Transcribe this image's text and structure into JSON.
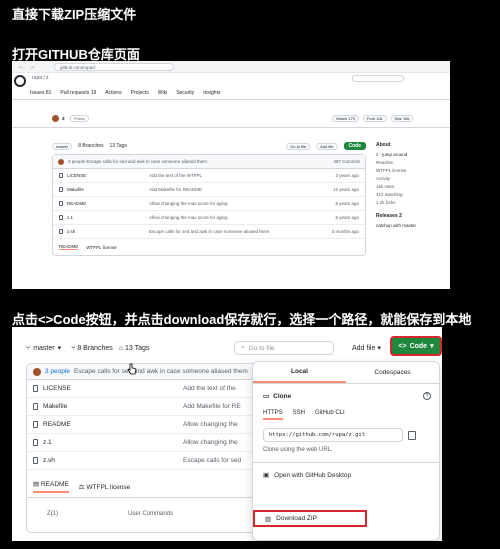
{
  "headings": {
    "step1": "直接下载ZIP压缩文件",
    "step2": "打开GITHUB仓库页面",
    "step3": "点击<>Code按钮，并点击download保存就行，选择一个路径，就能保存到本地"
  },
  "shot1": {
    "url": "github.com/rupa/z",
    "top_path": "rupa / z",
    "tabs": [
      "Issues 81",
      "Pull requests 19",
      "Actions",
      "Projects",
      "Wiki",
      "Security",
      "Insights"
    ],
    "owner": "z",
    "visibility": "Public",
    "watch": "Watch 179",
    "fork": "Fork 12k",
    "star": "Star 16k",
    "branch": "master",
    "branches": "8 Branches",
    "tags": "13 Tags",
    "go_to_file": "Go to file",
    "add_file": "Add file",
    "code": "Code",
    "commit_msg": "3 people  Escape calls for sed and awk in case someone aliased them",
    "commit_count": "287 Commits",
    "files": [
      {
        "name": "LICENSE",
        "msg": "Add the text of the WTFPL",
        "time": "3 years ago"
      },
      {
        "name": "Makefile",
        "msg": "Add Makefile for README",
        "time": "12 years ago"
      },
      {
        "name": "README",
        "msg": "Allow changing the max score for aging",
        "time": "6 years ago"
      },
      {
        "name": "z.1",
        "msg": "Allow changing the max score for aging",
        "time": "6 years ago"
      },
      {
        "name": "z.sh",
        "msg": "Escape calls for sed and awk in case someone aliased them",
        "time": "3 months ago"
      }
    ],
    "readme_tab": "README",
    "license_tab": "WTFPL license",
    "about_title": "About",
    "about_desc": "z - jump around",
    "about_items": [
      "Readme",
      "WTFPL license",
      "Activity",
      "16k stars",
      "312 watching",
      "1.2k forks"
    ],
    "releases": "Releases  2",
    "release_item": "catchup with master"
  },
  "shot2": {
    "branch": "master",
    "branches": "8 Branches",
    "tags": "13 Tags",
    "go_to_file": "Go to file",
    "add_file": "Add file",
    "code": "Code",
    "commit_people": "3 people",
    "commit_msg": "Escape calls for sed and awk in case someone aliased them",
    "files": [
      {
        "name": "LICENSE",
        "msg": "Add the text of the"
      },
      {
        "name": "Makefile",
        "msg": "Add Makefile for RE"
      },
      {
        "name": "README",
        "msg": "Allow changing the"
      },
      {
        "name": "z.1",
        "msg": "Allow changing the"
      },
      {
        "name": "z.sh",
        "msg": "Escape calls for sed"
      }
    ],
    "readme_tab": "README",
    "license_tab": "WTFPL license",
    "footer_left": "Z(1)",
    "footer_right": "User Commands",
    "popup": {
      "tab_local": "Local",
      "tab_codespaces": "Codespaces",
      "clone": "Clone",
      "protocols": [
        "HTTPS",
        "SSH",
        "GitHub CLI"
      ],
      "clone_url": "https://github.com/rupa/z.git",
      "hint": "Clone using the web URL.",
      "desktop": "Open with GitHub Desktop",
      "download": "Download ZIP"
    }
  },
  "colors": {
    "code_button": "#1f883d",
    "highlight_box": "#d9262c",
    "active_tab_underline": "#fd8c73"
  }
}
